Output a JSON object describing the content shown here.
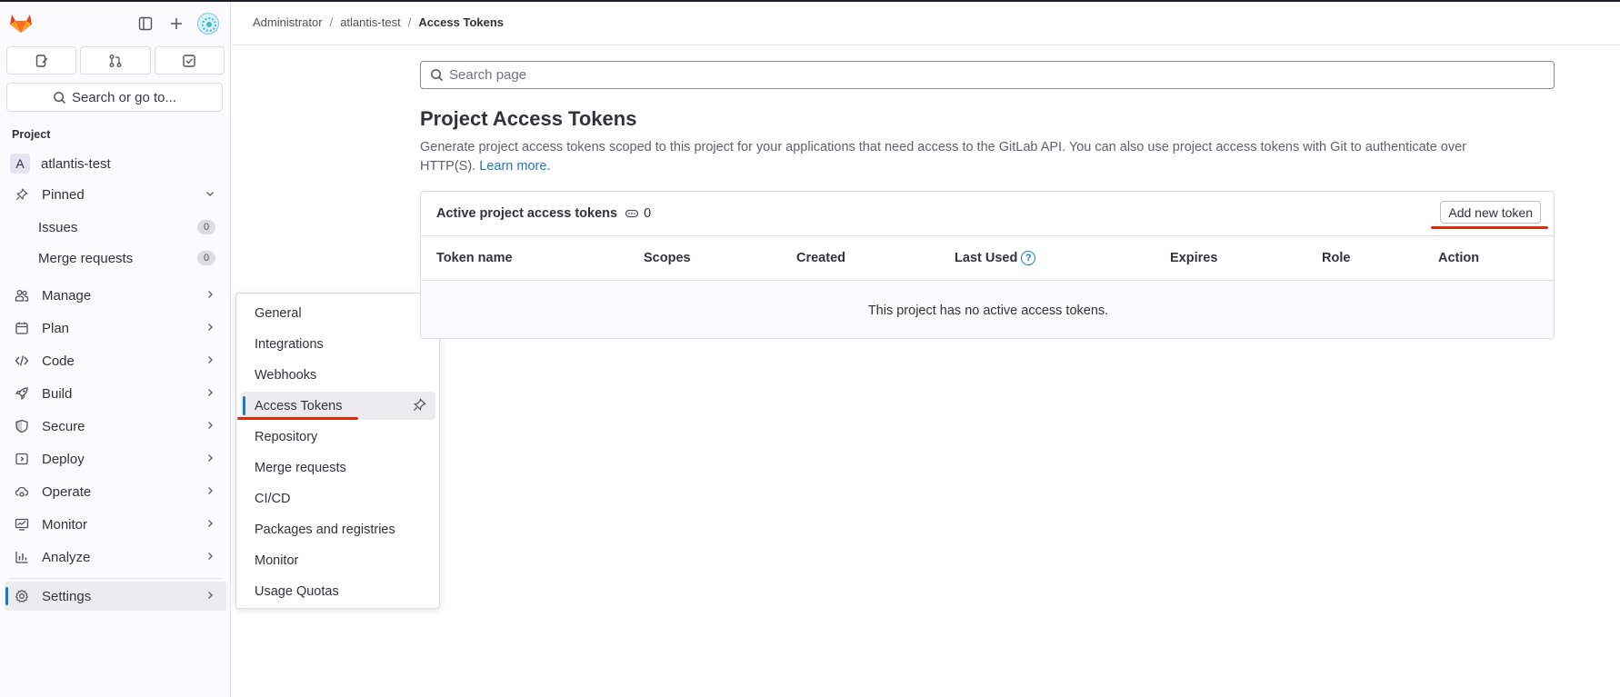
{
  "colors": {
    "accent": "#1f75cb",
    "annotation_red": "#dd2b0e",
    "text": "#333238"
  },
  "sidebar": {
    "tabs": [
      {
        "icon": "issues-icon"
      },
      {
        "icon": "merge-request-icon"
      },
      {
        "icon": "todo-icon"
      }
    ],
    "search_label": "Search or go to...",
    "section_label": "Project",
    "project": {
      "avatar_letter": "A",
      "name": "atlantis-test"
    },
    "pinned": {
      "label": "Pinned",
      "items": [
        {
          "label": "Issues",
          "count": "0"
        },
        {
          "label": "Merge requests",
          "count": "0"
        }
      ]
    },
    "nav": [
      {
        "label": "Manage",
        "icon": "users-icon"
      },
      {
        "label": "Plan",
        "icon": "calendar-icon"
      },
      {
        "label": "Code",
        "icon": "code-icon"
      },
      {
        "label": "Build",
        "icon": "rocket-icon"
      },
      {
        "label": "Secure",
        "icon": "shield-icon"
      },
      {
        "label": "Deploy",
        "icon": "deploy-icon"
      },
      {
        "label": "Operate",
        "icon": "cloud-gear-icon"
      },
      {
        "label": "Monitor",
        "icon": "monitor-icon"
      },
      {
        "label": "Analyze",
        "icon": "chart-icon"
      }
    ],
    "settings": {
      "label": "Settings",
      "icon": "gear-icon"
    }
  },
  "flyout": {
    "items": [
      "General",
      "Integrations",
      "Webhooks",
      "Access Tokens",
      "Repository",
      "Merge requests",
      "CI/CD",
      "Packages and registries",
      "Monitor",
      "Usage Quotas"
    ],
    "active": "Access Tokens"
  },
  "breadcrumb": [
    "Administrator",
    "atlantis-test",
    "Access Tokens"
  ],
  "main": {
    "search_placeholder": "Search page",
    "title": "Project Access Tokens",
    "description": "Generate project access tokens scoped to this project for your applications that need access to the GitLab API. You can also use project access tokens with Git to authenticate over HTTP(S).",
    "learn_more": "Learn more.",
    "card": {
      "title": "Active project access tokens",
      "count": "0",
      "add_button": "Add new token",
      "columns": [
        "Token name",
        "Scopes",
        "Created",
        "Last Used",
        "Expires",
        "Role",
        "Action"
      ],
      "empty_text": "This project has no active access tokens."
    }
  }
}
